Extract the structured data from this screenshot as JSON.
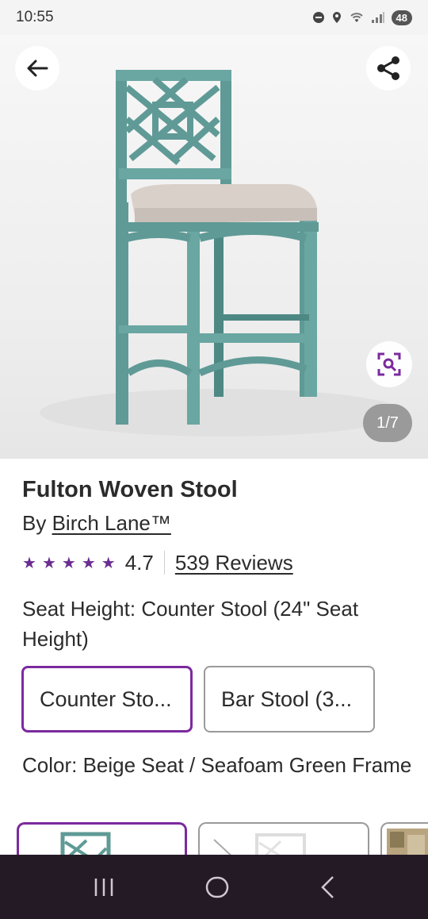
{
  "status_bar": {
    "time": "10:55",
    "battery": "48",
    "icons": [
      "do-not-disturb-icon",
      "location-icon",
      "wifi-icon",
      "signal-icon",
      "battery-icon"
    ]
  },
  "gallery": {
    "counter": "1/7",
    "back_icon": "arrow-left-icon",
    "share_icon": "share-icon",
    "zoom_icon": "visual-search-icon"
  },
  "product": {
    "title": "Fulton Woven Stool",
    "brand_prefix": "By",
    "brand": "Birch Lane™",
    "rating": "4.7",
    "stars": 5,
    "reviews": "539 Reviews"
  },
  "options": {
    "seat_height_label": "Seat Height: Counter Stool (24\" Seat Height)",
    "seat_height_choices": [
      "Counter Sto...",
      "Bar Stool (3..."
    ],
    "color_label": "Color: Beige Seat / Seafoam Green Frame"
  },
  "colors": {
    "accent": "#7b2a9e",
    "star": "#6b2c91",
    "frame": "#5f9a96",
    "seat": "#d9d0ca",
    "nav_bg": "#241a26"
  },
  "nav": {
    "icons": [
      "recent-apps-icon",
      "home-icon",
      "back-icon"
    ]
  }
}
